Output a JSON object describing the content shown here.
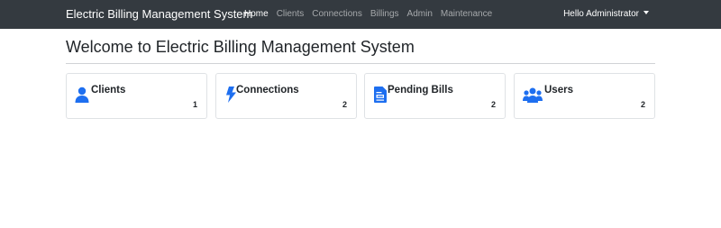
{
  "navbar": {
    "brand": "Electric Billing Management System",
    "links": [
      "Home",
      "Clients",
      "Connections",
      "Billings",
      "Admin",
      "Maintenance"
    ],
    "active_link": "Home",
    "user_menu": "Hello Administrator"
  },
  "page": {
    "title": "Welcome to Electric Billing Management System"
  },
  "cards": [
    {
      "label": "Clients",
      "count": "1",
      "icon": "user-icon"
    },
    {
      "label": "Connections",
      "count": "2",
      "icon": "bolt-icon"
    },
    {
      "label": "Pending Bills",
      "count": "2",
      "icon": "bill-icon"
    },
    {
      "label": "Users",
      "count": "2",
      "icon": "users-icon"
    }
  ],
  "colors": {
    "navbar_bg": "#343a40",
    "icon_blue": "#1e6ff0",
    "nav_inactive": "rgba(255,255,255,0.55)"
  }
}
